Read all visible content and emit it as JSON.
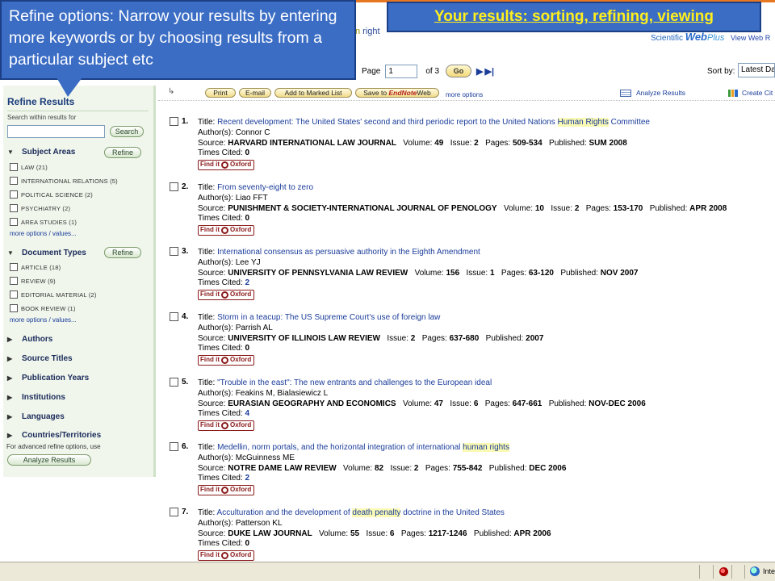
{
  "callouts": {
    "refine_text": "Refine options: Narrow your results by entering more keywords or by choosing results from a particular subject etc",
    "results_text": "Your results: sorting, refining, viewing"
  },
  "header": {
    "partial_text_hl": "n",
    "partial_text_rest": " right",
    "webplus_prefix": "Scientific",
    "webplus_brand": "Web",
    "webplus_plus": "Plus",
    "webplus_link": "View Web R",
    "page_label": "Page",
    "page_value": "1",
    "of_label": "of",
    "total_pages": "3",
    "go_label": "Go",
    "sort_label": "Sort by:",
    "sort_value": "Latest Da"
  },
  "toolbar": {
    "print": "Print",
    "email": "E-mail",
    "marked_list": "Add to Marked List",
    "save_to": "Save to",
    "endnote": "EndNote",
    "web": "Web",
    "more_options": "more options",
    "analyze_results": "Analyze Results",
    "create_citation": "Create Cit"
  },
  "sidebar": {
    "title": "Refine Results",
    "search_label": "Search within results for",
    "search_button": "Search",
    "refine_button": "Refine",
    "subject_areas": {
      "title": "Subject Areas",
      "options": [
        "LAW (21)",
        "INTERNATIONAL RELATIONS (5)",
        "POLITICAL SCIENCE (2)",
        "PSYCHIATRY (2)",
        "AREA STUDIES (1)"
      ],
      "more": "more options / values..."
    },
    "document_types": {
      "title": "Document Types",
      "options": [
        "ARTICLE (18)",
        "REVIEW (9)",
        "EDITORIAL MATERIAL (2)",
        "BOOK REVIEW (1)"
      ],
      "more": "more options / values..."
    },
    "collapsed": [
      "Authors",
      "Source Titles",
      "Publication Years",
      "Institutions",
      "Languages",
      "Countries/Territories"
    ],
    "advanced_note": "For advanced refine options, use",
    "analyze_button": "Analyze Results"
  },
  "labels": {
    "title": "Title: ",
    "authors": "Author(s): ",
    "source": "Source: ",
    "volume": "Volume: ",
    "issue": "Issue: ",
    "pages": "Pages: ",
    "published": "Published: ",
    "times_cited": "Times Cited: ",
    "find_it": "Find it",
    "oxford": "Oxford"
  },
  "results": [
    {
      "num": "1.",
      "title_before": "Recent development: The United States' second and third periodic report to the United Nations ",
      "title_hl": "Human Rights",
      "title_after": " Committee",
      "authors": "Connor C",
      "source": "HARVARD INTERNATIONAL LAW JOURNAL",
      "volume": "49",
      "issue": "2",
      "pages": "509-534",
      "published": "SUM 2008",
      "times_cited": "0"
    },
    {
      "num": "2.",
      "title_before": "From seventy-eight to zero",
      "title_hl": "",
      "title_after": "",
      "authors": "Liao FFT",
      "source": "PUNISHMENT & SOCIETY-INTERNATIONAL JOURNAL OF PENOLOGY",
      "volume": "10",
      "issue": "2",
      "pages": "153-170",
      "published": "APR 2008",
      "times_cited": "0"
    },
    {
      "num": "3.",
      "title_before": "International consensus as persuasive authority in the Eighth Amendment",
      "title_hl": "",
      "title_after": "",
      "authors": "Lee YJ",
      "source": "UNIVERSITY OF PENNSYLVANIA LAW REVIEW",
      "volume": "156",
      "issue": "1",
      "pages": "63-120",
      "published": "NOV 2007",
      "times_cited": "2"
    },
    {
      "num": "4.",
      "title_before": "Storm in a teacup: The US Supreme Court's use of foreign law",
      "title_hl": "",
      "title_after": "",
      "authors": "Parrish AL",
      "source": "UNIVERSITY OF ILLINOIS LAW REVIEW",
      "volume": "",
      "issue": "2",
      "pages": "637-680",
      "published": "2007",
      "times_cited": "0"
    },
    {
      "num": "5.",
      "title_before": "\"Trouble in the east\": The new entrants and challenges to the European ideal",
      "title_hl": "",
      "title_after": "",
      "authors": "Feakins M, Bialasiewicz L",
      "source": "EURASIAN GEOGRAPHY AND ECONOMICS",
      "volume": "47",
      "issue": "6",
      "pages": "647-661",
      "published": "NOV-DEC 2006",
      "times_cited": "4"
    },
    {
      "num": "6.",
      "title_before": "Medellin, norm portals, and the horizontal integration of international ",
      "title_hl": "human rights",
      "title_after": "",
      "authors": "McGuinness ME",
      "source": "NOTRE DAME LAW REVIEW",
      "volume": "82",
      "issue": "2",
      "pages": "755-842",
      "published": "DEC 2006",
      "times_cited": "2"
    },
    {
      "num": "7.",
      "title_before": "Acculturation and the development of ",
      "title_hl": "death penalty",
      "title_after": " doctrine in the United States",
      "authors": "Patterson KL",
      "source": "DUKE LAW JOURNAL",
      "volume": "55",
      "issue": "6",
      "pages": "1217-1246",
      "published": "APR 2006",
      "times_cited": "0"
    }
  ],
  "statusbar": {
    "zone": "Inte"
  }
}
